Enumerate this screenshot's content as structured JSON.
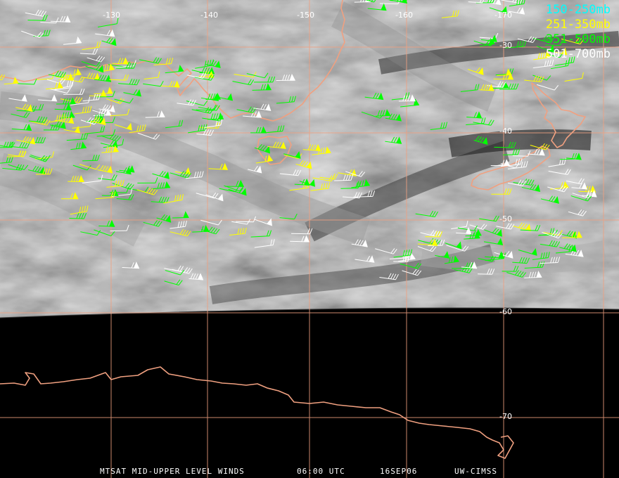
{
  "map": {
    "longitude_labels": [
      "-130",
      "-140",
      "-150",
      "-160",
      "-170"
    ],
    "latitude_labels": [
      "-30",
      "-40",
      "-50",
      "-60",
      "-70"
    ]
  },
  "legend": [
    {
      "label": "150-250mb",
      "color": "#00ffff"
    },
    {
      "label": "251-350mb",
      "color": "#ffff00"
    },
    {
      "label": "351-500mb",
      "color": "#00ff00"
    },
    {
      "label": "501-700mb",
      "color": "#ffffff"
    }
  ],
  "footer": {
    "product": "MTSAT MID-UPPER LEVEL WINDS",
    "time": "06:00 UTC",
    "date": "16SEP06",
    "source": "UW-CIMSS"
  },
  "colors": {
    "coastline": "#f0a080",
    "gridline": "#f0a080",
    "space_background": "#000000"
  }
}
